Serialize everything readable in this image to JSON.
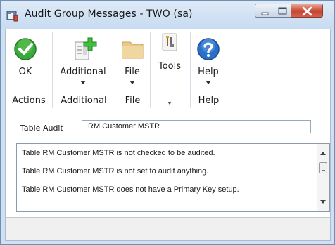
{
  "window": {
    "title": "Audit Group Messages  -  TWO (sa)"
  },
  "ribbon": {
    "buttons": [
      {
        "label": "OK",
        "icon": "ok-check-icon"
      },
      {
        "label": "Additional",
        "icon": "additional-add-icon"
      },
      {
        "label": "File",
        "icon": "folder-icon"
      },
      {
        "label": "Tools",
        "icon": "tools-icon"
      },
      {
        "label": "Help",
        "icon": "help-icon"
      }
    ],
    "groups": [
      "Actions",
      "Additional",
      "File",
      "Help"
    ]
  },
  "form": {
    "table_audit_label": "Table Audit",
    "table_audit_value": "RM Customer MSTR",
    "messages": [
      "Table RM Customer MSTR is not checked to be audited.",
      "Table RM Customer MSTR is not set to audit anything.",
      "Table RM Customer MSTR does not have a Primary Key setup."
    ]
  },
  "colors": {
    "ok_green": "#3aa83a",
    "help_blue": "#2a6fc9",
    "close_red": "#c7452f",
    "folder_tan": "#e8c98a"
  }
}
